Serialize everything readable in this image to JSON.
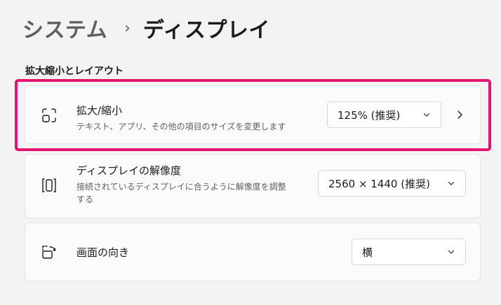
{
  "breadcrumb": {
    "parent": "システム",
    "separator": "›",
    "current": "ディスプレイ"
  },
  "section": {
    "title": "拡大縮小とレイアウト"
  },
  "scale": {
    "title": "拡大/縮小",
    "description": "テキスト、アプリ、その他の項目のサイズを変更します",
    "value": "125% (推奨)",
    "icon": "scale-icon"
  },
  "resolution": {
    "title": "ディスプレイの解像度",
    "description_line1": "接続されているディスプレイに合うように解像度を調整",
    "description_line2": "する",
    "value": "2560 × 1440 (推奨)",
    "icon": "resolution-icon"
  },
  "orientation": {
    "title": "画面の向き",
    "value": "横",
    "icon": "orientation-icon"
  },
  "colors": {
    "highlight": "#e4156f",
    "card_bg": "#fbfbfb",
    "page_bg": "#f3f3f3"
  }
}
